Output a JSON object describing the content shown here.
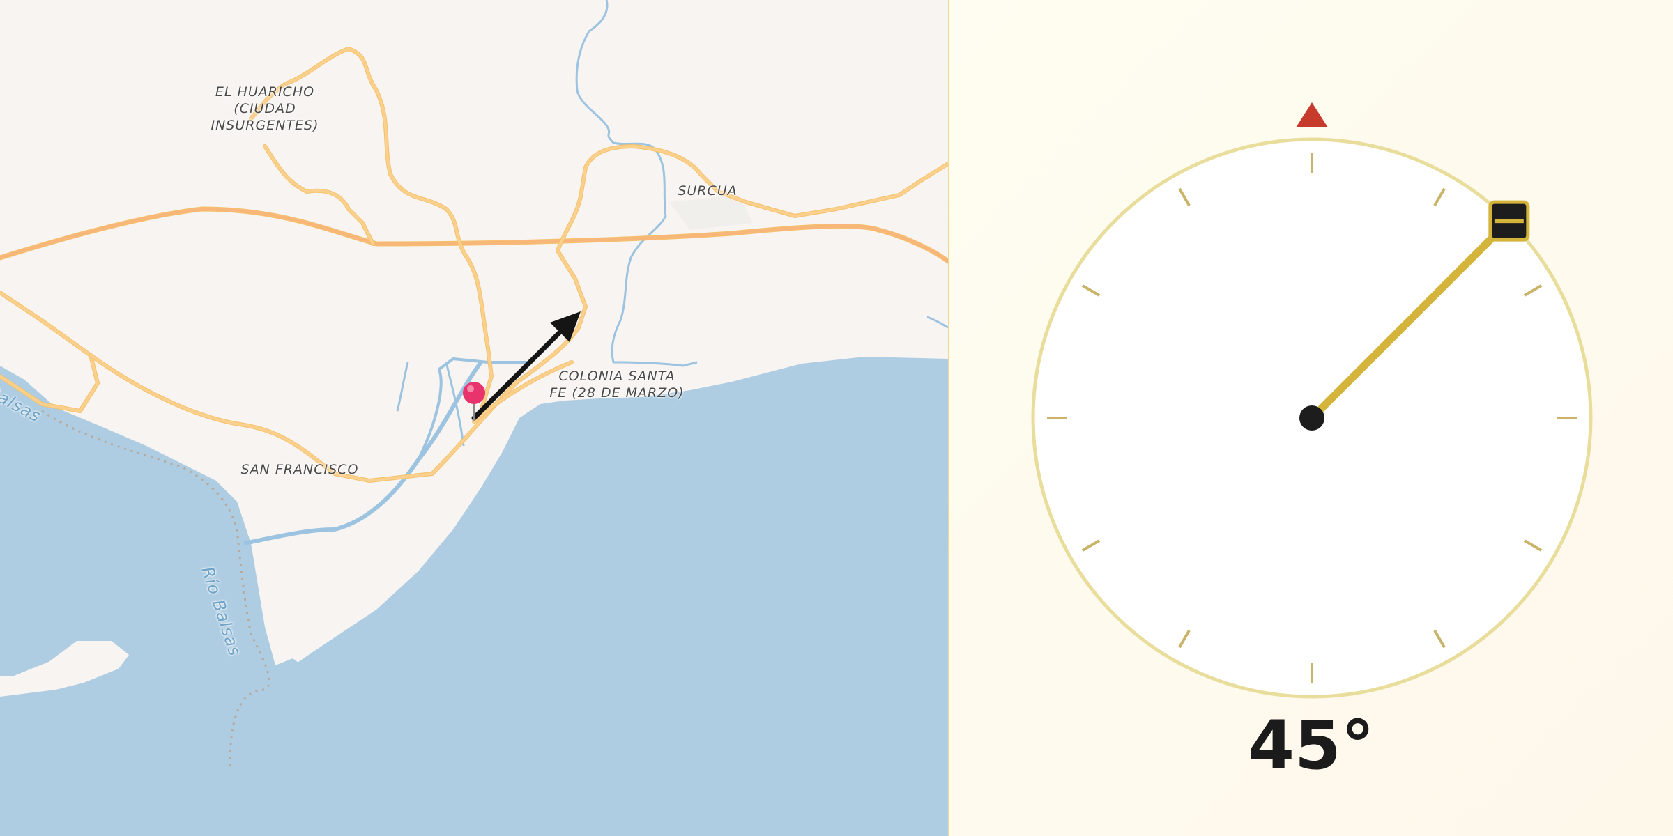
{
  "map": {
    "places": [
      {
        "key": "el-huaricho",
        "label": "EL HUARICHO\n(CIUDAD\nINSURGENTES)"
      },
      {
        "key": "surcua",
        "label": "SURCUA"
      },
      {
        "key": "colonia-santa-fe",
        "label": "COLONIA SANTA\nFE (28 DE MARZO)"
      },
      {
        "key": "san-francisco",
        "label": "SAN FRANCISCO"
      }
    ],
    "rivers": [
      {
        "key": "rio-balsas-main",
        "label": "Río Balsas"
      },
      {
        "key": "rio-balsas-west",
        "label": "Balsas"
      }
    ],
    "colors": {
      "land": "#f7f4f1",
      "water": "#aecde2",
      "river": "#9cc3df",
      "road": "#fbd08d",
      "highway": "#f9b679",
      "pin": "#e8336c",
      "arrow": "#151515"
    }
  },
  "dial": {
    "heading_deg": 45,
    "heading_text": "45°",
    "north_marker_color": "#c63b2c",
    "ring_color": "#e9dd9c",
    "needle_color": "#d4b43a",
    "handle_color": "#1d1d1d"
  }
}
